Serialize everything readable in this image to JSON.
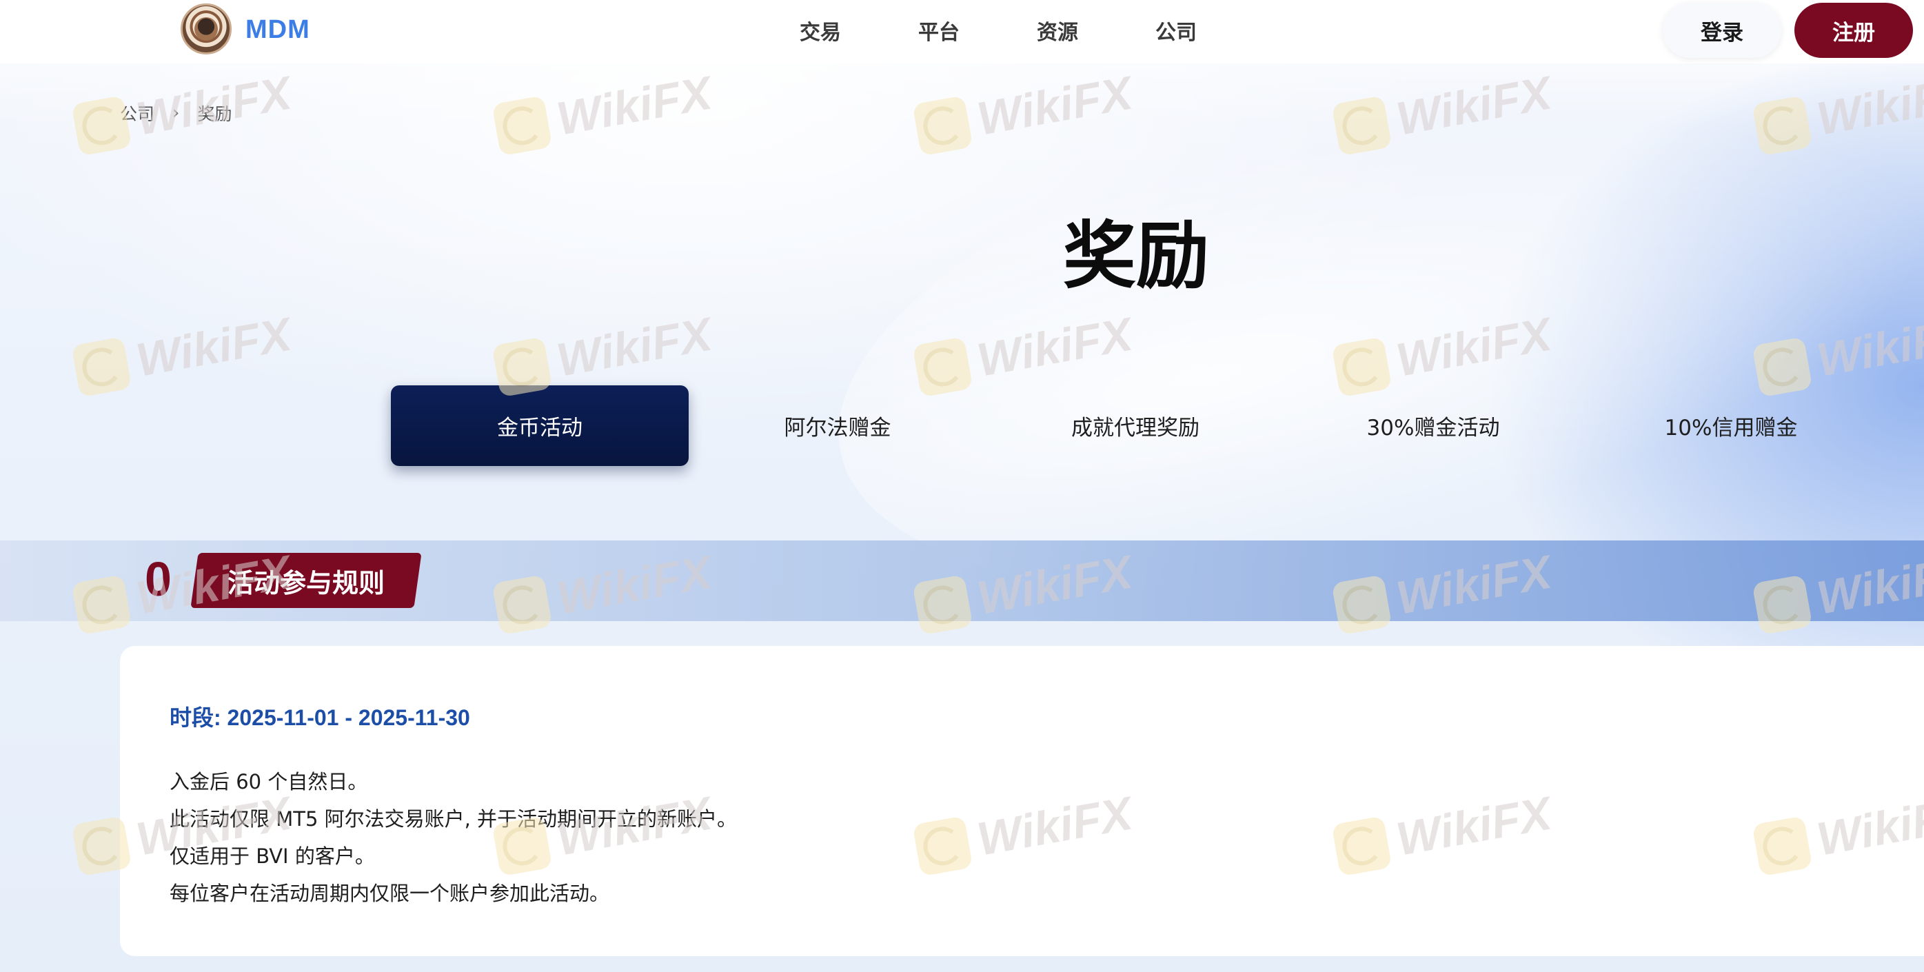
{
  "header": {
    "brand": "MDM",
    "nav": [
      "交易",
      "平台",
      "资源",
      "公司"
    ],
    "login_label": "登录",
    "register_label": "注册"
  },
  "breadcrumb": {
    "parent": "公司",
    "separator": "›",
    "current": "奖励"
  },
  "page_title": "奖励",
  "tabs": [
    {
      "label": "金币活动",
      "active": true
    },
    {
      "label": "阿尔法赠金",
      "active": false
    },
    {
      "label": "成就代理奖励",
      "active": false
    },
    {
      "label": "30%赠金活动",
      "active": false
    },
    {
      "label": "10%信用赠金",
      "active": false
    }
  ],
  "section": {
    "number": "0",
    "title": "活动参与规则"
  },
  "card": {
    "period": "时段: 2025-11-01 - 2025-11-30",
    "rules": [
      "入金后 60 个自然日。",
      "此活动仅限 MT5 阿尔法交易账户, 并于活动期间开立的新账户。",
      "仅适用于 BVI 的客户。",
      "每位客户在活动周期内仅限一个账户参加此活动。"
    ]
  },
  "watermark": {
    "text": "WikiFX"
  },
  "colors": {
    "brand_blue": "#3d7ee6",
    "accent_maroon": "#7a0a22",
    "active_tab_navy": "#0c1f57",
    "period_blue": "#1c4ea8"
  }
}
